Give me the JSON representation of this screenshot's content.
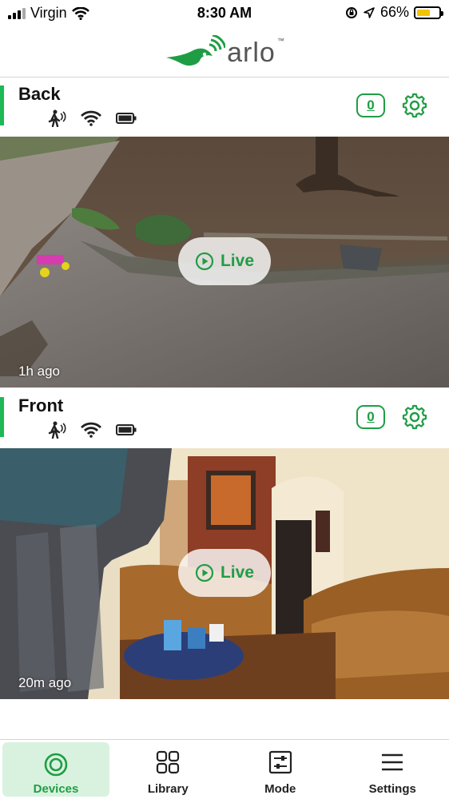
{
  "status_bar": {
    "carrier": "Virgin",
    "time": "8:30 AM",
    "battery_percent": "66%",
    "battery_level": 0.66
  },
  "app": {
    "logo_text": "arlo",
    "logo_tm": "™"
  },
  "cameras": [
    {
      "name": "Back",
      "count": "0",
      "live_label": "Live",
      "last_seen": "1h ago"
    },
    {
      "name": "Front",
      "count": "0",
      "live_label": "Live",
      "last_seen": "20m ago"
    }
  ],
  "nav": {
    "tabs": [
      {
        "label": "Devices",
        "icon": "devices-icon",
        "active": true
      },
      {
        "label": "Library",
        "icon": "library-grid-icon",
        "active": false
      },
      {
        "label": "Mode",
        "icon": "mode-sliders-icon",
        "active": false
      },
      {
        "label": "Settings",
        "icon": "menu-icon",
        "active": false
      }
    ]
  },
  "colors": {
    "brand_green": "#1f9d45",
    "accent_bar": "#1db954",
    "battery_fill": "#f3c300"
  }
}
